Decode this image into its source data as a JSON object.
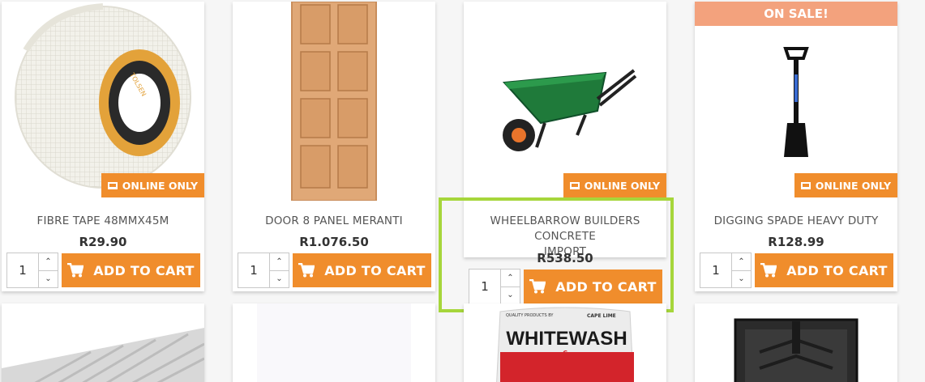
{
  "products": [
    {
      "name_line1": "FIBRE TAPE 48MMX45M",
      "name_line2": "",
      "price": "R29.90",
      "qty": "1",
      "badge": "ONLINE ONLY",
      "image": "fibre-tape-image"
    },
    {
      "name_line1": "DOOR 8 PANEL MERANTI",
      "name_line2": "",
      "price": "R1.076.50",
      "qty": "1",
      "badge": "",
      "image": "door-image"
    },
    {
      "name_line1": "WHEELBARROW BUILDERS CONCRETE",
      "name_line2": "IMPORT",
      "price": "R538.50",
      "qty": "1",
      "badge": "ONLINE ONLY",
      "image": "wheelbarrow-image"
    },
    {
      "name_line1": "DIGGING SPADE HEAVY DUTY",
      "name_line2": "",
      "price": "R128.99",
      "qty": "1",
      "badge": "ONLINE ONLY",
      "sale_badge": "ON SALE!",
      "image": "spade-image"
    }
  ],
  "add_to_cart_label": "ADD TO CART",
  "icons": {
    "cart": "cart-icon",
    "laptop": "laptop-icon",
    "spin_up": "chevron-up-icon",
    "spin_down": "chevron-down-icon"
  },
  "row2": {
    "whitewash_brand": "CAPE LIME",
    "whitewash_title": "WHITEWASH",
    "whitewash_small": "QUALITY PRODUCTS BY"
  },
  "colors": {
    "accent": "#f08d2c",
    "sale": "#f3a27d",
    "highlight": "#a6d63b"
  }
}
